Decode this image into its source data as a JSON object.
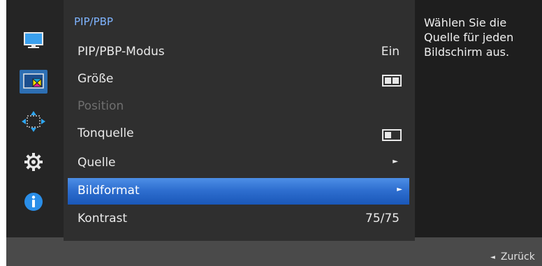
{
  "sidebar": {
    "items": [
      {
        "icon": "monitor-icon"
      },
      {
        "icon": "pip-pbp-icon",
        "active": true
      },
      {
        "icon": "position-arrows-icon"
      },
      {
        "icon": "settings-gear-icon"
      },
      {
        "icon": "info-icon"
      }
    ]
  },
  "menu": {
    "title": "PIP/PBP",
    "rows": [
      {
        "label": "PIP/PBP-Modus",
        "value": "Ein"
      },
      {
        "label": "Größe",
        "value_icon": "split-screen-icon"
      },
      {
        "label": "Position",
        "disabled": true
      },
      {
        "label": "Tonquelle",
        "value_icon": "single-screen-icon"
      },
      {
        "label": "Quelle",
        "arrow": "►"
      },
      {
        "label": "Bildformat",
        "arrow": "►",
        "selected": true
      },
      {
        "label": "Kontrast",
        "value": "75/75"
      }
    ]
  },
  "tip": {
    "text": "Wählen Sie die Quelle für jeden Bildschirm aus."
  },
  "footer": {
    "back_icon": "◄",
    "back_label": "Zurück"
  },
  "colors": {
    "accent": "#2f6fd0",
    "title": "#7fb4ff",
    "background": "#1e1e1e"
  }
}
